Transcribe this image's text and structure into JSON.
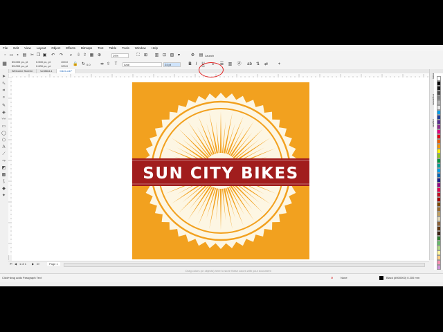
{
  "menu": [
    "File",
    "Edit",
    "View",
    "Layout",
    "Object",
    "Effects",
    "Bitmaps",
    "Text",
    "Table",
    "Tools",
    "Window",
    "Help"
  ],
  "toolbar": {
    "zoom": "29%",
    "launch_label": "Launch"
  },
  "property_bar": {
    "pos_x": "55.000 pc, pt",
    "pos_y": "55.000 pc, pt",
    "w_val": "0.000 pc, pt",
    "h_val": "0.000 pc, pt",
    "scale_x": "100.0",
    "scale_y": "100.0",
    "angle": "0.0",
    "font_name": "Arial",
    "font_size": "24 pt",
    "bold": "B",
    "italic": "I",
    "underline": "U"
  },
  "tabs": [
    "Welcome Screen",
    "Untitled-1",
    "bikes.cdr*"
  ],
  "artwork": {
    "title": "SUN CITY BIKES",
    "bg_color": "#f2a11f",
    "banner_color": "#a11d1d",
    "ring_color": "#fdf6e3"
  },
  "page_nav": {
    "current": "1 of 1",
    "page_label": "Page 1"
  },
  "canvas_hint": "Drag colors (or objects) here to store these colors with your document",
  "status": {
    "hint": "Click+drag adds Paragraph Text",
    "fill_label": "None",
    "outline_label": "Black (#000000)  0.200 mm"
  },
  "dockers": [
    "Hints",
    "Properties",
    "Objects"
  ],
  "palette": [
    "#ffffff",
    "#000000",
    "#1a1a1a",
    "#4d4d4d",
    "#808080",
    "#b3b3b3",
    "#e6e6e6",
    "#00a0e9",
    "#1f3c99",
    "#5a2d91",
    "#8e2a8e",
    "#e4007f",
    "#e60012",
    "#eb6100",
    "#f39800",
    "#fff100",
    "#8fc31f",
    "#009944",
    "#009e96",
    "#00a0e9",
    "#0068b7",
    "#1d2088",
    "#920783",
    "#e5004f",
    "#c30d23",
    "#a40000",
    "#7d4900",
    "#996c33",
    "#c0a062",
    "#dfd5b5",
    "#8c6239",
    "#603813",
    "#3c2415",
    "#2e7d32",
    "#66bb6a",
    "#aed581",
    "#fff59d",
    "#ffcc80",
    "#f48fb1",
    "#ce93d8"
  ]
}
